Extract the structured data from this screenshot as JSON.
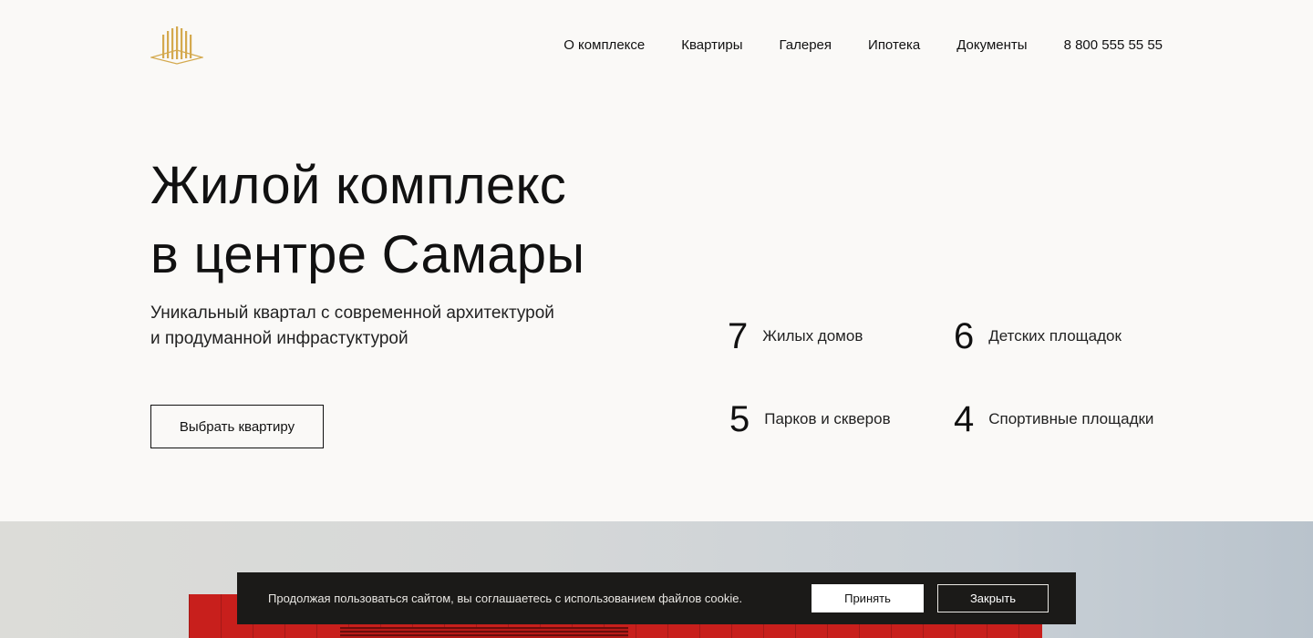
{
  "brand": {
    "logo_icon": "building-logo-icon",
    "accent_color": "#c9a24e"
  },
  "nav": {
    "items": [
      {
        "label": "О комплексе"
      },
      {
        "label": "Квартиры"
      },
      {
        "label": "Галерея"
      },
      {
        "label": "Ипотека"
      },
      {
        "label": "Документы"
      }
    ],
    "phone": "8 800 555 55 55"
  },
  "hero": {
    "title_line1": "Жилой комплекс",
    "title_line2": "в центре Самары",
    "subtitle_line1": "Уникальный квартал с современной архитектурой",
    "subtitle_line2": "и продуманной инфрастуктурой",
    "cta_label": "Выбрать квартиру"
  },
  "stats": [
    {
      "value": "7",
      "label": "Жилых домов"
    },
    {
      "value": "6",
      "label": "Детских площадок"
    },
    {
      "value": "5",
      "label": "Парков и скверов"
    },
    {
      "value": "4",
      "label": "Спортивные площадки"
    }
  ],
  "cookie": {
    "text": "Продолжая пользоваться сайтом, вы соглашаетесь с использованием файлов cookie.",
    "accept_label": "Принять",
    "close_label": "Закрыть"
  }
}
